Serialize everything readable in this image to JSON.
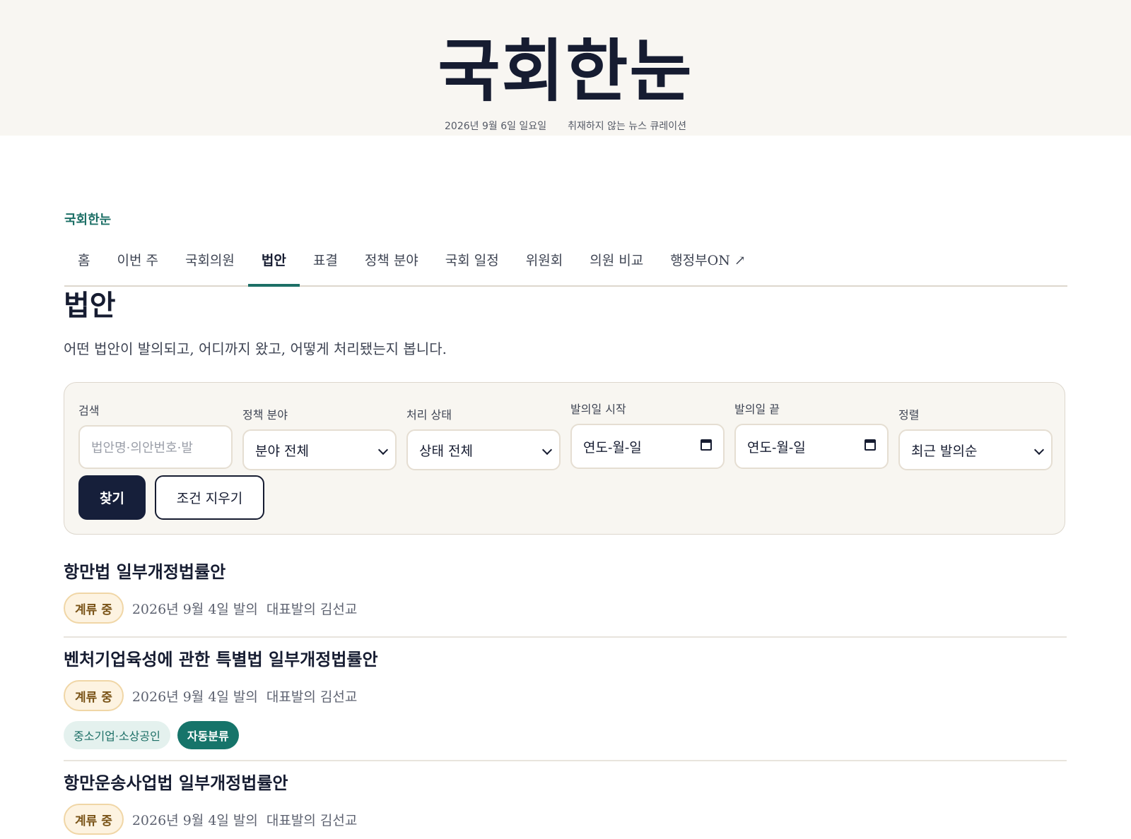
{
  "masthead": {
    "logo": "국회한눈",
    "date": "2026년 9월 6일 일요일",
    "tagline": "취재하지 않는 뉴스 큐레이션"
  },
  "brand": "국회한눈",
  "nav": [
    {
      "label": "홈"
    },
    {
      "label": "이번 주"
    },
    {
      "label": "국회의원"
    },
    {
      "label": "법안",
      "active": true
    },
    {
      "label": "표결"
    },
    {
      "label": "정책 분야"
    },
    {
      "label": "국회 일정"
    },
    {
      "label": "위원회"
    },
    {
      "label": "의원 비교"
    },
    {
      "label": "행정부ON ↗"
    }
  ],
  "page": {
    "title": "법안",
    "description": "어떤 법안이 발의되고, 어디까지 왔고, 어떻게 처리됐는지 봅니다."
  },
  "filters": {
    "search": {
      "label": "검색",
      "placeholder": "법안명·의안번호·발"
    },
    "policy_field": {
      "label": "정책 분야",
      "value": "분야 전체"
    },
    "status": {
      "label": "처리 상태",
      "value": "상태 전체"
    },
    "date_start": {
      "label": "발의일 시작",
      "value": "연도-월-일"
    },
    "date_end": {
      "label": "발의일 끝",
      "value": "연도-월-일"
    },
    "sort": {
      "label": "정렬",
      "value": "최근 발의순"
    },
    "submit_label": "찾기",
    "clear_label": "조건 지우기"
  },
  "bills": [
    {
      "title": "항만법 일부개정법률안",
      "status": "계류 중",
      "date": "2026년 9월 4일 발의",
      "sponsor": "대표발의 김선교",
      "tags": []
    },
    {
      "title": "벤처기업육성에 관한 특별법 일부개정법률안",
      "status": "계류 중",
      "date": "2026년 9월 4일 발의",
      "sponsor": "대표발의 김선교",
      "tags": [
        "중소기업·소상공인",
        "자동분류"
      ]
    },
    {
      "title": "항만운송사업법 일부개정법률안",
      "status": "계류 중",
      "date": "2026년 9월 4일 발의",
      "sponsor": "대표발의 김선교",
      "tags": []
    }
  ],
  "colors": {
    "accent": "#1c6f66",
    "navy": "#161f3a",
    "status_badge_bg": "#fdf3e1",
    "masthead_bg": "#f8f6f2"
  }
}
